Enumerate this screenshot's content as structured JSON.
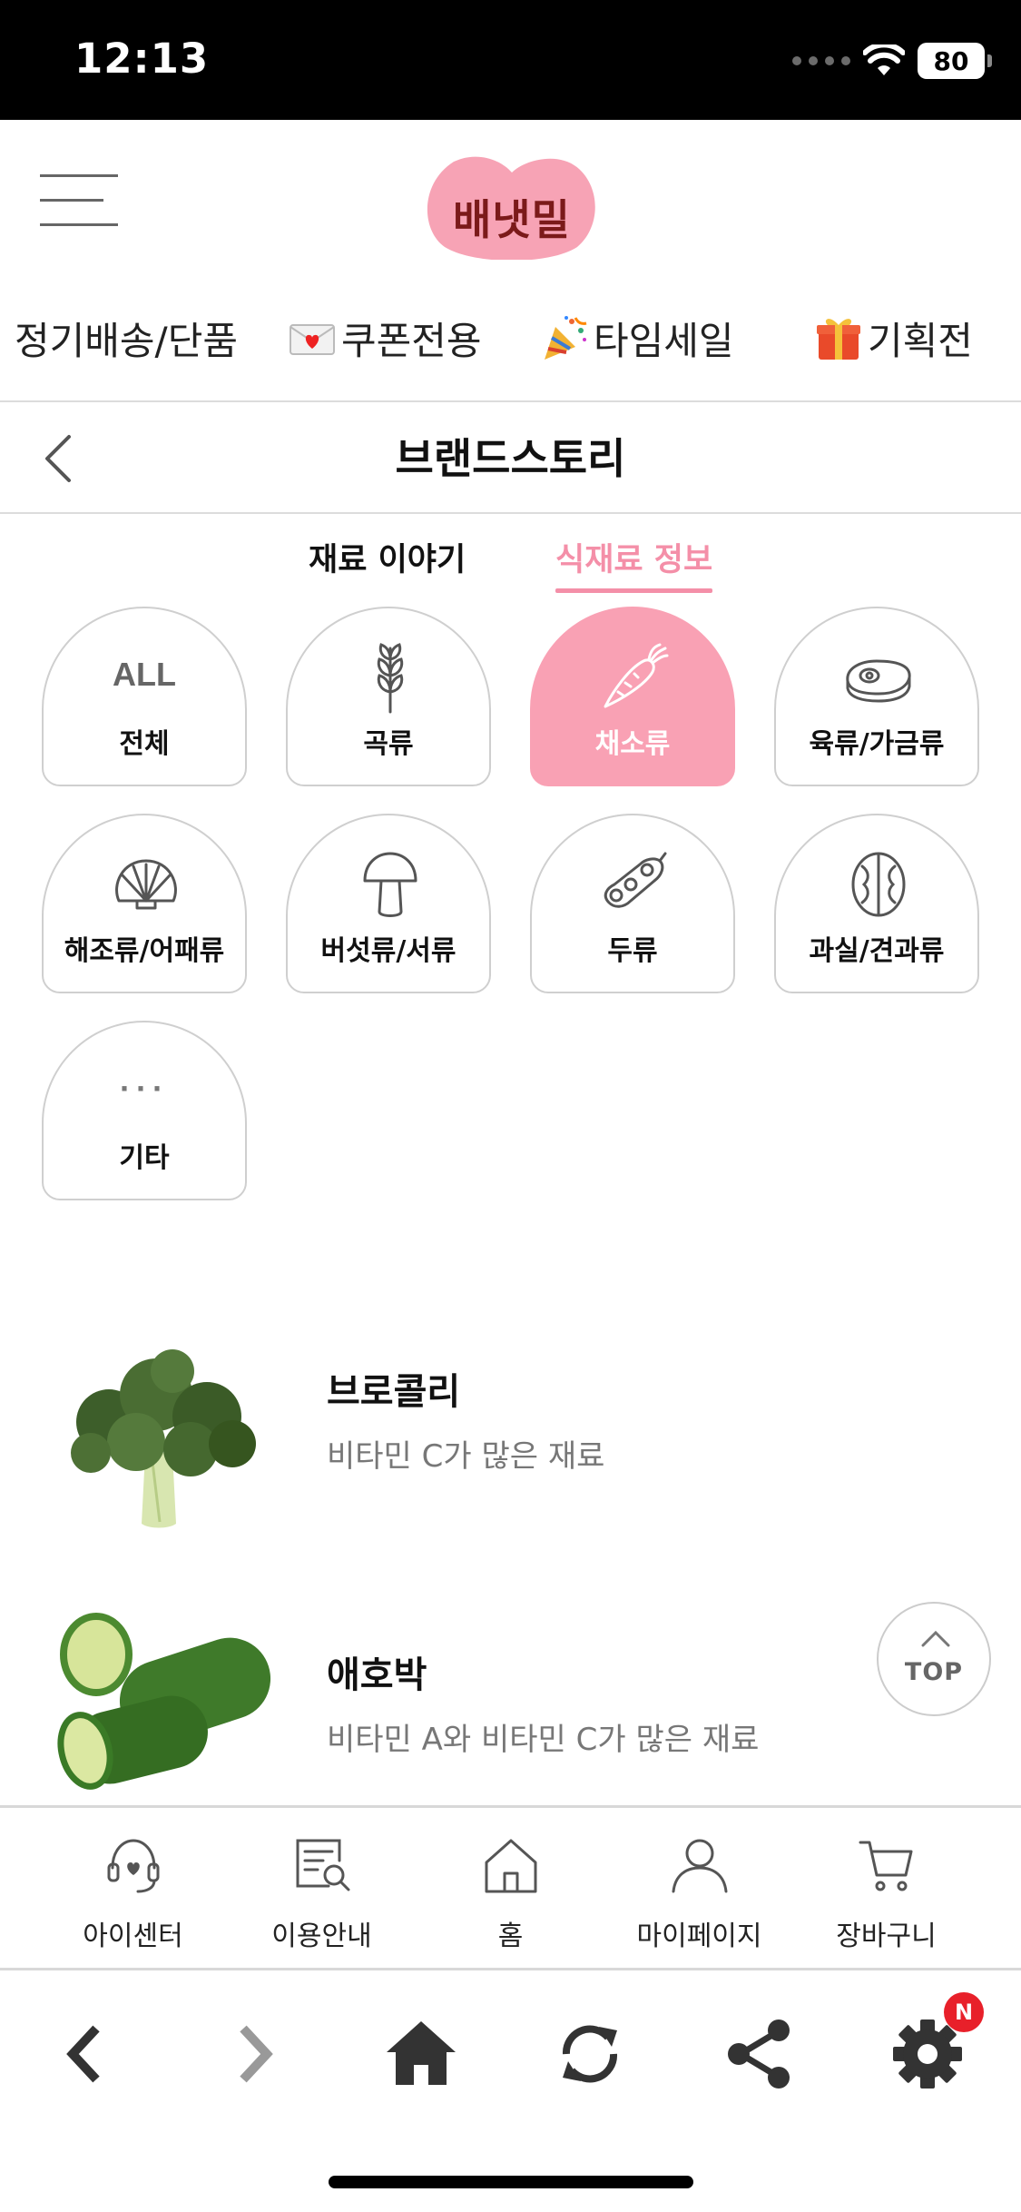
{
  "status_bar": {
    "time": "12:13",
    "battery": "80"
  },
  "header": {
    "logo_text": "배냇밀",
    "logo_color": "#f7a3b5"
  },
  "category_nav": [
    {
      "label": "정기배송/단품",
      "icon": ""
    },
    {
      "label": "쿠폰전용",
      "icon": "love-letter-icon"
    },
    {
      "label": "타임세일",
      "icon": "party-popper-icon"
    },
    {
      "label": "기획전",
      "icon": "gift-icon"
    }
  ],
  "page": {
    "title": "브랜드스토리"
  },
  "sub_tabs": [
    {
      "label": "재료 이야기",
      "active": false
    },
    {
      "label": "식재료 정보",
      "active": true
    }
  ],
  "categories": [
    {
      "label": "전체",
      "icon": "all-text-icon",
      "icon_text": "ALL",
      "active": false
    },
    {
      "label": "곡류",
      "icon": "wheat-icon",
      "active": false
    },
    {
      "label": "채소류",
      "icon": "carrot-icon",
      "active": true
    },
    {
      "label": "육류/가금류",
      "icon": "steak-icon",
      "active": false
    },
    {
      "label": "해조류/어패류",
      "icon": "shell-icon",
      "active": false
    },
    {
      "label": "버섯류/서류",
      "icon": "mushroom-icon",
      "active": false
    },
    {
      "label": "두류",
      "icon": "pea-pod-icon",
      "active": false
    },
    {
      "label": "과실/견과류",
      "icon": "walnut-icon",
      "active": false
    },
    {
      "label": "기타",
      "icon": "ellipsis-icon",
      "icon_text": "···",
      "active": false
    }
  ],
  "ingredients": [
    {
      "name": "브로콜리",
      "desc": "비타민 C가 많은 재료",
      "image": "broccoli-image"
    },
    {
      "name": "애호박",
      "desc": "비타민 A와 비타민 C가 많은 재료",
      "image": "zucchini-image"
    }
  ],
  "top_button": {
    "label": "TOP"
  },
  "bottom_nav": [
    {
      "label": "아이센터",
      "icon": "headset-icon"
    },
    {
      "label": "이용안내",
      "icon": "guide-search-icon"
    },
    {
      "label": "홈",
      "icon": "house-outline-icon"
    },
    {
      "label": "마이페이지",
      "icon": "person-icon"
    },
    {
      "label": "장바구니",
      "icon": "cart-icon"
    }
  ],
  "browser_toolbar": {
    "settings_badge": "N"
  },
  "colors": {
    "accent": "#f48fa8",
    "active_cell": "#f9a1b4",
    "badge": "#e8202a",
    "logo_text": "#7b1a1a"
  }
}
